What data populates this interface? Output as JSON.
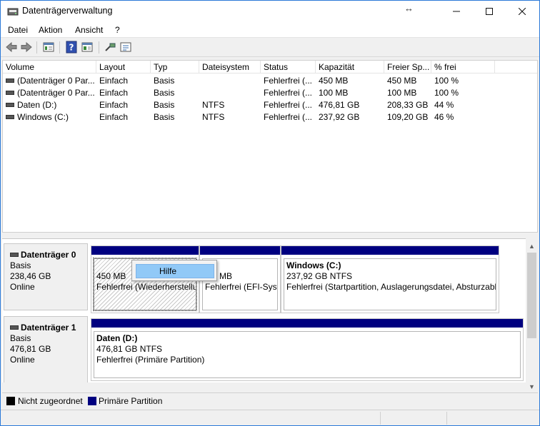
{
  "window": {
    "title": "Datenträgerverwaltung"
  },
  "menu": [
    "Datei",
    "Aktion",
    "Ansicht",
    "?"
  ],
  "toolbar_icons": [
    "back-arrow-icon",
    "forward-arrow-icon",
    "properties-icon",
    "help-icon",
    "console-tree-icon",
    "connect-icon",
    "settings-list-icon"
  ],
  "volumes": {
    "columns": [
      "Volume",
      "Layout",
      "Typ",
      "Dateisystem",
      "Status",
      "Kapazität",
      "Freier Sp...",
      "% frei"
    ],
    "rows": [
      [
        "(Datenträger 0 Par...",
        "Einfach",
        "Basis",
        "",
        "Fehlerfrei (...",
        "450 MB",
        "450 MB",
        "100 %"
      ],
      [
        "(Datenträger 0 Par...",
        "Einfach",
        "Basis",
        "",
        "Fehlerfrei (...",
        "100 MB",
        "100 MB",
        "100 %"
      ],
      [
        "Daten (D:)",
        "Einfach",
        "Basis",
        "NTFS",
        "Fehlerfrei (...",
        "476,81 GB",
        "208,33 GB",
        "44 %"
      ],
      [
        "Windows (C:)",
        "Einfach",
        "Basis",
        "NTFS",
        "Fehlerfrei (...",
        "237,92 GB",
        "109,20 GB",
        "46 %"
      ]
    ]
  },
  "disks": [
    {
      "name": "Datenträger 0",
      "type": "Basis",
      "size": "238,46 GB",
      "state": "Online",
      "partitions": [
        {
          "name": "",
          "size": "450 MB",
          "status": "Fehlerfrei (Wiederherstellu"
        },
        {
          "name": "",
          "size": "MB",
          "status": "Fehlerfrei (EFI-Syst"
        },
        {
          "name": "Windows  (C:)",
          "size": "237,92 GB NTFS",
          "status": "Fehlerfrei (Startpartition, Auslagerungsdatei, Absturzabb"
        }
      ]
    },
    {
      "name": "Datenträger 1",
      "type": "Basis",
      "size": "476,81 GB",
      "state": "Online",
      "partitions": [
        {
          "name": "Daten  (D:)",
          "size": "476,81 GB NTFS",
          "status": "Fehlerfrei (Primäre Partition)"
        }
      ]
    }
  ],
  "context_menu": {
    "item": "Hilfe"
  },
  "legend": [
    {
      "label": "Nicht zugeordnet",
      "color": "#000000"
    },
    {
      "label": "Primäre Partition",
      "color": "#000080"
    }
  ],
  "colors": {
    "primary_partition": "#000080",
    "accent_border": "#2b79d8",
    "menu_highlight": "#91c9f7"
  }
}
